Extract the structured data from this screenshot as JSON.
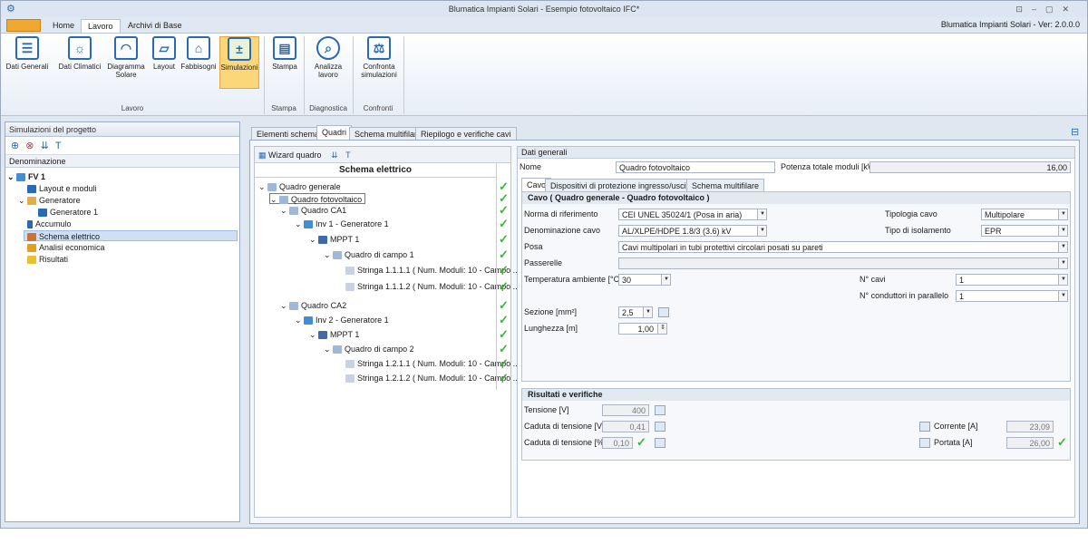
{
  "window": {
    "title": "Blumatica Impianti Solari - Esempio fotovoltaico IFC*",
    "version": "Blumatica Impianti Solari - Ver: 2.0.0.0"
  },
  "ribbon_tabs": [
    "Home",
    "Lavoro",
    "Archivi di Base"
  ],
  "ribbon_buttons": [
    "Dati Generali",
    "Dati Climatici",
    "Diagramma Solare",
    "Layout",
    "Fabbisogni",
    "Simulazioni",
    "Stampa",
    "Analizza lavoro",
    "Confronta simulazioni"
  ],
  "ribbon_groups": [
    "Lavoro",
    "Stampa",
    "Diagnostica",
    "Confronti"
  ],
  "left": {
    "title": "Simulazioni del progetto",
    "col": "Denominazione",
    "tree": [
      "FV 1",
      "Layout e moduli",
      "Generatore",
      "Generatore 1",
      "Accumulo",
      "Schema elettrico",
      "Analisi economica",
      "Risultati"
    ]
  },
  "center_tabs": [
    "Elementi schema",
    "Quadri",
    "Schema multifilare",
    "Riepilogo e verifiche cavi"
  ],
  "tree": {
    "wizard": "Wizard quadro",
    "title": "Schema elettrico",
    "items": [
      "Quadro generale",
      "Quadro fotovoltaico",
      "Quadro CA1",
      "Inv 1 - Generatore 1",
      "MPPT 1",
      "Quadro di campo 1",
      "Stringa 1.1.1.1 ( Num. Moduli: 10 - Campo ...",
      "Stringa 1.1.1.2 ( Num. Moduli: 10 - Campo ...",
      "Quadro CA2",
      "Inv 2 - Generatore 1",
      "MPPT 1",
      "Quadro di campo 2",
      "Stringa 1.2.1.1 ( Num. Moduli: 10 - Campo ...",
      "Stringa 1.2.1.2 ( Num. Moduli: 10 - Campo ..."
    ]
  },
  "detail": {
    "section": "Dati generali",
    "nome_lbl": "Nome",
    "nome": "Quadro fotovoltaico",
    "pot_lbl": "Potenza totale moduli [kW]",
    "pot": "16,00",
    "tabs": [
      "Cavo",
      "Dispositivi di protezione ingresso/uscita",
      "Schema multifilare"
    ],
    "cavo_title": "Cavo ( Quadro generale - Quadro fotovoltaico )",
    "norma_lbl": "Norma di riferimento",
    "norma": "CEI UNEL 35024/1 (Posa in aria)",
    "tipologia_lbl": "Tipologia cavo",
    "tipologia": "Multipolare",
    "denom_lbl": "Denominazione cavo",
    "denom": "AL/XLPE/HDPE 1.8/3 (3.6) kV",
    "isol_lbl": "Tipo di isolamento",
    "isol": "EPR",
    "posa_lbl": "Posa",
    "posa": "Cavi multipolari in tubi protettivi circolari posati su pareti",
    "passerelle_lbl": "Passerelle",
    "temp_lbl": "Temperatura ambiente [°C]",
    "temp": "30",
    "ncavi_lbl": "N° cavi",
    "ncavi": "1",
    "ncond_lbl": "N° conduttori in parallelo",
    "ncond": "1",
    "sez_lbl": "Sezione [mm²]",
    "sez": "2,5",
    "lung_lbl": "Lunghezza [m]",
    "lung": "1,00",
    "ris_title": "Risultati e verifiche",
    "tens_lbl": "Tensione [V]",
    "tens": "400",
    "cadv_lbl": "Caduta di tensione [V]",
    "cadv": "0,41",
    "cadp_lbl": "Caduta di tensione [%]",
    "cadp": "0,10",
    "corr_lbl": "Corrente [A]",
    "corr": "23,09",
    "port_lbl": "Portata [A]",
    "port": "26,00"
  }
}
